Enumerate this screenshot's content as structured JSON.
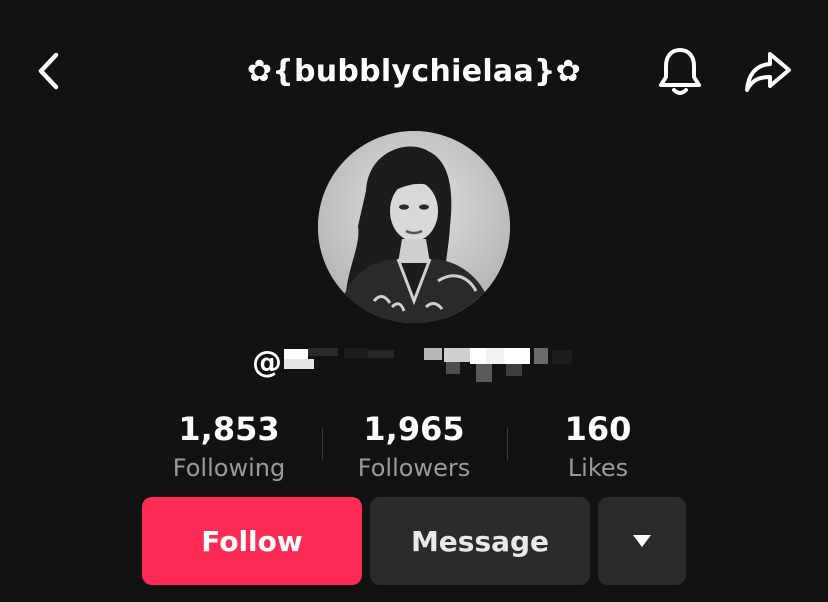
{
  "header": {
    "title": "✿{bubblychielaa}✿",
    "back_icon": "chevron-left-icon",
    "notification_icon": "bell-icon",
    "share_icon": "share-arrow-icon"
  },
  "profile": {
    "handle_prefix": "@",
    "handle_redacted": true
  },
  "stats": [
    {
      "value": "1,853",
      "label": "Following"
    },
    {
      "value": "1,965",
      "label": "Followers"
    },
    {
      "value": "160",
      "label": "Likes"
    }
  ],
  "actions": {
    "follow_label": "Follow",
    "message_label": "Message",
    "more_icon": "caret-down-icon"
  },
  "colors": {
    "background": "#121212",
    "accent": "#fe2c55",
    "secondary_button": "#2b2b2b",
    "muted_text": "#9a9a9a"
  }
}
